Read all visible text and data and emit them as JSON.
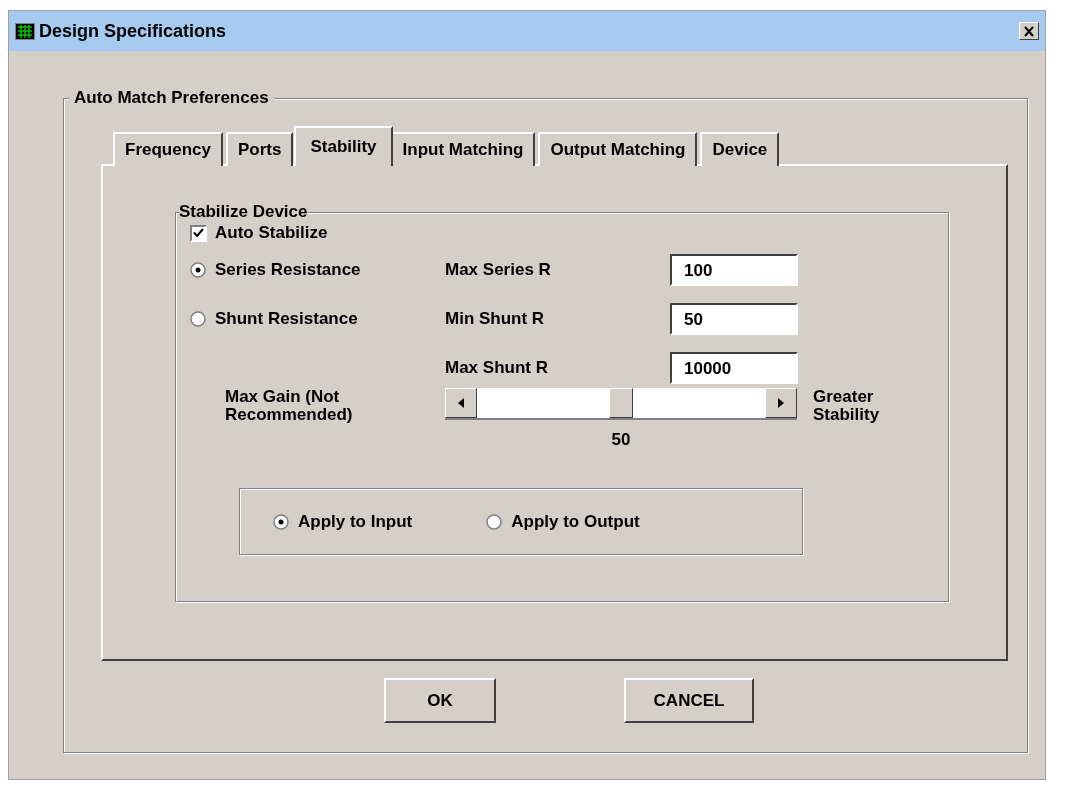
{
  "window": {
    "title": "Design Specifications"
  },
  "group": {
    "title": "Auto Match Preferences"
  },
  "tabs": [
    {
      "label": "Frequency",
      "selected": false
    },
    {
      "label": "Ports",
      "selected": false
    },
    {
      "label": "Stability",
      "selected": true
    },
    {
      "label": "Input Matching",
      "selected": false
    },
    {
      "label": "Output Matching",
      "selected": false
    },
    {
      "label": "Device",
      "selected": false
    }
  ],
  "stabilize": {
    "title": "Stabilize Device",
    "auto_stabilize": {
      "label": "Auto Stabilize",
      "checked": true
    },
    "rows": [
      {
        "option": {
          "label": "Series Resistance",
          "selected": true
        },
        "field": {
          "label": "Max Series R",
          "value": "100"
        }
      },
      {
        "option": {
          "label": "Shunt Resistance",
          "selected": false
        },
        "field": {
          "label": "Min Shunt R",
          "value": "50"
        }
      },
      {
        "field": {
          "label": "Max Shunt R",
          "value": "10000"
        }
      }
    ],
    "slider": {
      "left_label": "Max Gain (Not Recommended)",
      "right_label": "Greater Stability",
      "level": 0.5,
      "reading": "50"
    },
    "apply_options": [
      {
        "label": "Apply to Input",
        "selected": true
      },
      {
        "label": "Apply to Output",
        "selected": false
      }
    ]
  },
  "buttons": [
    {
      "label": "OK"
    },
    {
      "label": "CANCEL"
    }
  ]
}
